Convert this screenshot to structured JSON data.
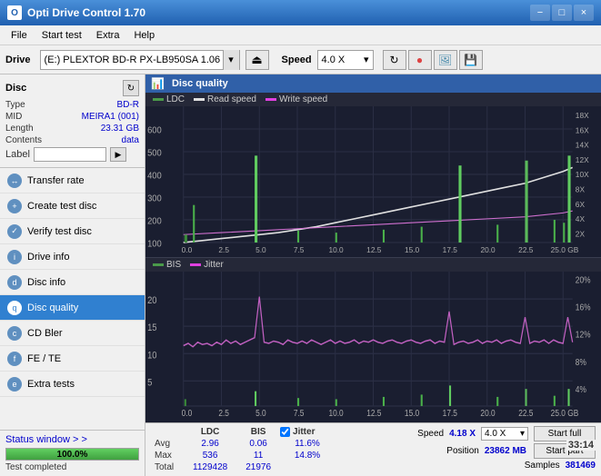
{
  "window": {
    "title": "Opti Drive Control 1.70",
    "minimize": "−",
    "maximize": "□",
    "close": "×"
  },
  "menu": {
    "items": [
      "File",
      "Start test",
      "Extra",
      "Help"
    ]
  },
  "drive_bar": {
    "label": "Drive",
    "drive_name": "(E:)  PLEXTOR BD-R  PX-LB950SA 1.06",
    "speed_label": "Speed",
    "speed_value": "4.0 X"
  },
  "disc": {
    "title": "Disc",
    "type_label": "Type",
    "type_val": "BD-R",
    "mid_label": "MID",
    "mid_val": "MEIRA1 (001)",
    "length_label": "Length",
    "length_val": "23.31 GB",
    "contents_label": "Contents",
    "contents_val": "data",
    "label_label": "Label",
    "label_val": ""
  },
  "nav": {
    "items": [
      {
        "id": "transfer-rate",
        "label": "Transfer rate",
        "icon": "↔"
      },
      {
        "id": "create-test-disc",
        "label": "Create test disc",
        "icon": "+"
      },
      {
        "id": "verify-test-disc",
        "label": "Verify test disc",
        "icon": "✓"
      },
      {
        "id": "drive-info",
        "label": "Drive info",
        "icon": "i"
      },
      {
        "id": "disc-info",
        "label": "Disc info",
        "icon": "d"
      },
      {
        "id": "disc-quality",
        "label": "Disc quality",
        "icon": "q",
        "active": true
      },
      {
        "id": "cd-bler",
        "label": "CD Bler",
        "icon": "c"
      },
      {
        "id": "fe-te",
        "label": "FE / TE",
        "icon": "f"
      },
      {
        "id": "extra-tests",
        "label": "Extra tests",
        "icon": "e"
      }
    ]
  },
  "status": {
    "label": "Status window > >",
    "progress": "100.0%",
    "progress_pct": 100,
    "message": "Test completed",
    "time": "33:14"
  },
  "chart": {
    "title": "Disc quality",
    "top_legend": {
      "ldc_label": "LDC",
      "read_label": "Read speed",
      "write_label": "Write speed"
    },
    "bottom_legend": {
      "bis_label": "BIS",
      "jitter_label": "Jitter"
    },
    "top_y_max": 600,
    "top_y_labels": [
      "600",
      "500",
      "400",
      "300",
      "200",
      "100"
    ],
    "top_y_right": [
      "18X",
      "16X",
      "14X",
      "12X",
      "10X",
      "8X",
      "6X",
      "4X",
      "2X"
    ],
    "x_labels": [
      "0.0",
      "2.5",
      "5.0",
      "7.5",
      "10.0",
      "12.5",
      "15.0",
      "17.5",
      "20.0",
      "22.5",
      "25.0 GB"
    ],
    "bottom_y_labels": [
      "20",
      "15",
      "10",
      "5"
    ],
    "bottom_y_right": [
      "20%",
      "16%",
      "12%",
      "8%",
      "4%"
    ]
  },
  "stats": {
    "col_ldc": "LDC",
    "col_bis": "BIS",
    "jitter_label": "Jitter",
    "jitter_checked": true,
    "speed_label": "Speed",
    "speed_val": "4.18 X",
    "speed_combo": "4.0 X",
    "row_avg": "Avg",
    "row_max": "Max",
    "row_total": "Total",
    "avg_ldc": "2.96",
    "avg_bis": "0.06",
    "avg_jitter": "11.6%",
    "max_ldc": "536",
    "max_bis": "11",
    "max_jitter": "14.8%",
    "total_ldc": "1129428",
    "total_bis": "21976",
    "total_jitter": "",
    "position_label": "Position",
    "position_val": "23862 MB",
    "samples_label": "Samples",
    "samples_val": "381469",
    "btn_start_full": "Start full",
    "btn_start_part": "Start part"
  }
}
